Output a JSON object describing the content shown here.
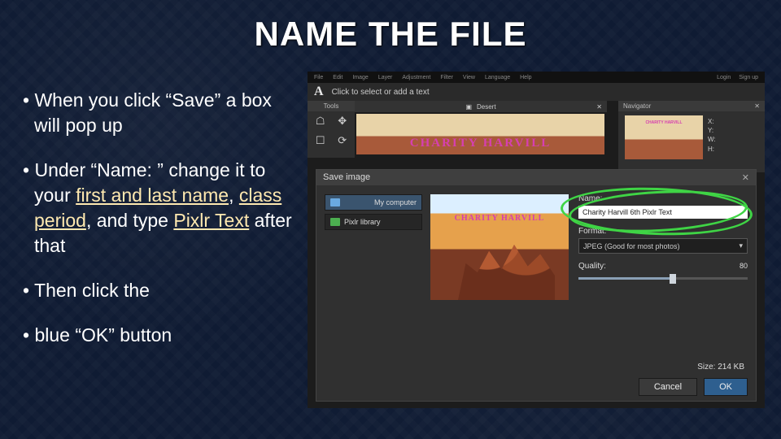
{
  "title": "NAME THE FILE",
  "bullets": {
    "b1a": "When you click “Save” a box will pop up",
    "b2a": "Under “Name: ” change it to your ",
    "b2_hl1": "first and last name",
    "b2_mid": ", ",
    "b2_hl2": "class period",
    "b2_mid2": ", and type ",
    "b2_hl3": "Pixlr Text",
    "b2_end": " after that",
    "b3": "Then click the",
    "b4": "blue “OK” button"
  },
  "editor": {
    "menus": [
      "File",
      "Edit",
      "Image",
      "Layer",
      "Adjustment",
      "Filter",
      "View",
      "Language",
      "Help"
    ],
    "rightmenus": [
      "Login",
      "Sign up"
    ],
    "texttool_glyph": "A",
    "texttool_hint": "Click to select or add a text",
    "tools_label": "Tools",
    "doc_title": "Desert",
    "doc_pin": "▣",
    "doc_close": "✕",
    "canvas_text": "CHARITY HARVILL",
    "navigator": {
      "title": "Navigator",
      "close": "✕",
      "thumb_text": "CHARITY HARVILL",
      "meta": {
        "x": "X:",
        "y": "Y:",
        "w": "W:",
        "h": "H:"
      }
    }
  },
  "dialog": {
    "title": "Save image",
    "close": "✕",
    "left_items": [
      {
        "icon": "computer",
        "label": "My computer",
        "selected": true
      },
      {
        "icon": "pixlr",
        "label": "Pixlr library",
        "selected": false
      }
    ],
    "preview_text": "CHARITY HARVILL",
    "name_label": "Name:",
    "name_value": "Charity Harvill 6th Pixlr Text",
    "format_label": "Format:",
    "format_value": "JPEG (Good for most photos)",
    "format_caret": "▾",
    "quality_label": "Quality:",
    "quality_value": "80",
    "size_label": "Size: 214 KB",
    "cancel": "Cancel",
    "ok": "OK"
  }
}
